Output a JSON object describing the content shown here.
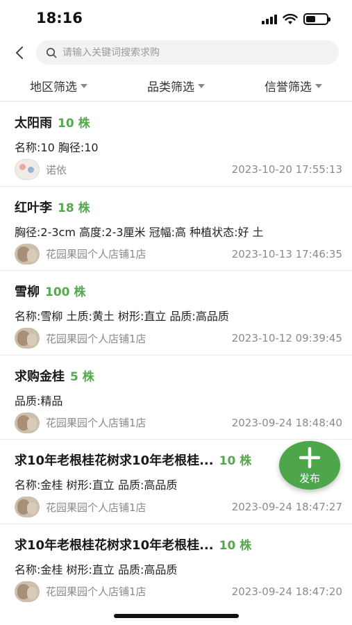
{
  "status_bar": {
    "time": "18:16",
    "battery_level": 0.45
  },
  "search": {
    "placeholder": "请输入关键词搜索求购",
    "value": ""
  },
  "icons": {
    "back": "chevron-left-icon",
    "search": "search-icon",
    "caret": "caret-down-icon",
    "add": "plus-icon"
  },
  "filters": [
    {
      "label": "地区筛选"
    },
    {
      "label": "品类筛选"
    },
    {
      "label": "信誉筛选"
    }
  ],
  "colors": {
    "accent": "#56a84f",
    "fab": "#4da649",
    "muted_text": "#8a8a8a"
  },
  "items": [
    {
      "title": "太阳雨",
      "quantity": "10 株",
      "attrs": "名称:10  胸径:10",
      "shop": "诺依",
      "time": "2023-10-20 17:55:13"
    },
    {
      "title": "红叶李",
      "quantity": "18 株",
      "attrs": "胸径:2-3cm  高度:2-3厘米  冠幅:高  种植状态:好  土",
      "shop": "花园果园个人店铺1店",
      "time": "2023-10-13 17:46:35"
    },
    {
      "title": "雪柳",
      "quantity": "100 株",
      "attrs": "名称:雪柳  土质:黄土  树形:直立  品质:高品质",
      "shop": "花园果园个人店铺1店",
      "time": "2023-10-12 09:39:45"
    },
    {
      "title": "求购金桂",
      "quantity": "5 株",
      "attrs": "品质:精品",
      "shop": "花园果园个人店铺1店",
      "time": "2023-09-24 18:48:40"
    },
    {
      "title": "求10年老根桂花树求10年老根桂...",
      "quantity": "10 株",
      "attrs": "名称:金桂  树形:直立  品质:高品质",
      "shop": "花园果园个人店铺1店",
      "time": "2023-09-24 18:47:27"
    },
    {
      "title": "求10年老根桂花树求10年老根桂...",
      "quantity": "10 株",
      "attrs": "名称:金桂  树形:直立  品质:高品质",
      "shop": "花园果园个人店铺1店",
      "time": "2023-09-24 18:47:20"
    }
  ],
  "fab": {
    "label": "发布"
  }
}
